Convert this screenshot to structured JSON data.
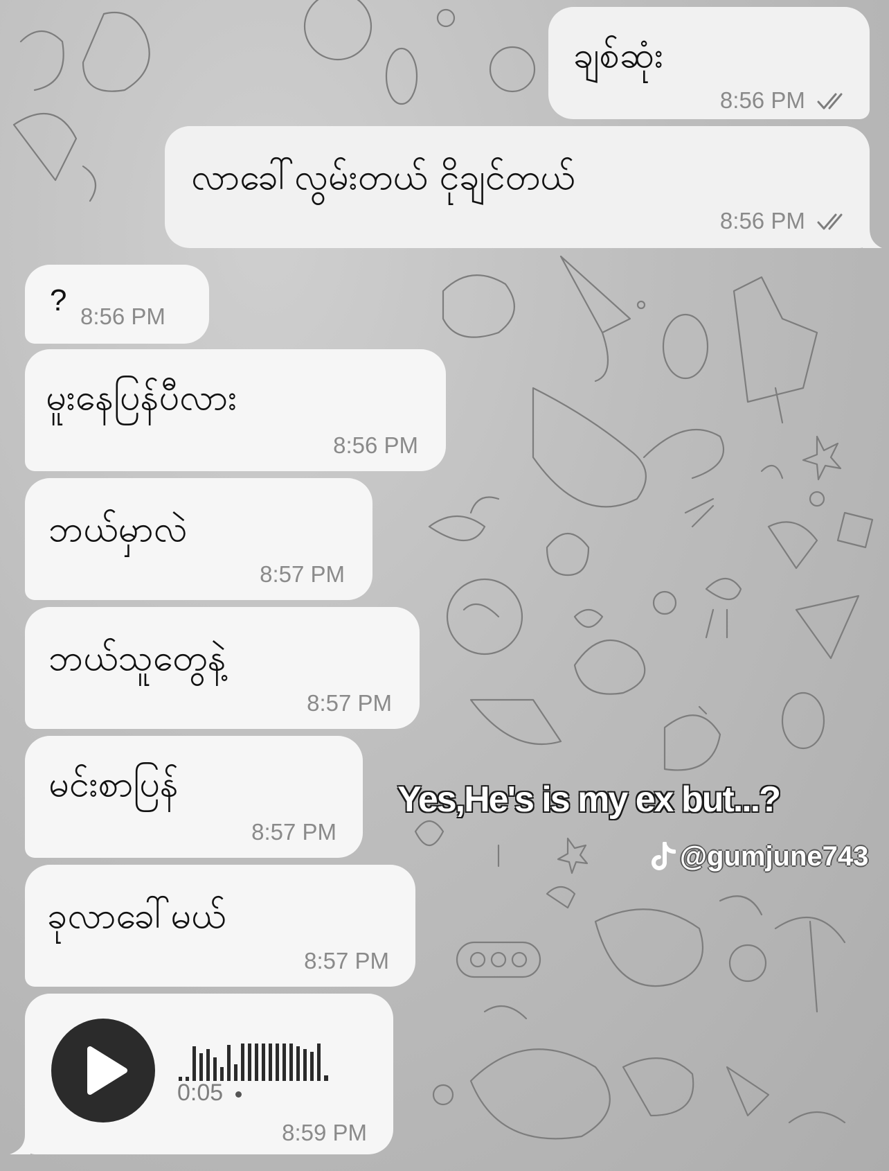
{
  "chat": {
    "messages": [
      {
        "direction": "outgoing",
        "text": "ချစ်ဆုံး",
        "time": "8:56 PM",
        "status_icon": "double-check-icon"
      },
      {
        "direction": "outgoing",
        "text": "လာခေါ်လွမ်းတယ် ငိုချင်တယ်",
        "time": "8:56 PM",
        "status_icon": "double-check-icon"
      },
      {
        "direction": "incoming",
        "text": "?",
        "time": "8:56 PM"
      },
      {
        "direction": "incoming",
        "text": "မူးနေပြန်ပီလား",
        "time": "8:56 PM"
      },
      {
        "direction": "incoming",
        "text": "ဘယ်မှာလဲ",
        "time": "8:57 PM"
      },
      {
        "direction": "incoming",
        "text": "ဘယ်သူတွေနဲ့",
        "time": "8:57 PM"
      },
      {
        "direction": "incoming",
        "text": "မင်းစာပြန်",
        "time": "8:57 PM"
      },
      {
        "direction": "incoming",
        "text": "ခုလာခေါ်မယ်",
        "time": "8:57 PM"
      }
    ],
    "voice_message": {
      "direction": "incoming",
      "play_icon": "play-icon",
      "duration": "0:05",
      "time": "8:59 PM"
    }
  },
  "overlay": {
    "caption": "Yes,He's is my ex but...?",
    "watermark_icon": "tiktok-logo-icon",
    "watermark_handle": "@gumjune743"
  },
  "colors": {
    "outgoing_bubble": "#f1f1f1",
    "incoming_bubble": "#f6f6f6",
    "wallpaper": "#b9b9b9",
    "timestamp": "#8a8a8a"
  }
}
